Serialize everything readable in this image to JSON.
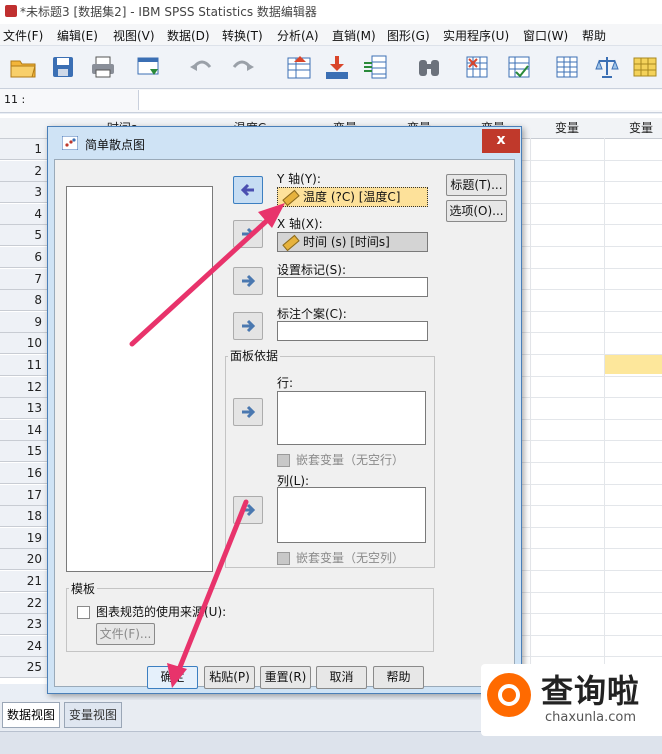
{
  "window": {
    "title": "*未标题3 [数据集2] - IBM SPSS Statistics 数据编辑器"
  },
  "menubar": {
    "items": [
      "文件(F)",
      "编辑(E)",
      "视图(V)",
      "数据(D)",
      "转换(T)",
      "分析(A)",
      "直销(M)",
      "图形(G)",
      "实用程序(U)",
      "窗口(W)",
      "帮助"
    ]
  },
  "toolbar": {
    "icons": [
      "open-folder-icon",
      "save-icon",
      "print-icon",
      "dialog-recall-icon",
      "undo-icon",
      "redo-icon",
      "goto-case-icon",
      "goto-variable-icon",
      "variables-icon",
      "find-icon",
      "insert-cases-icon",
      "split-file-icon",
      "weight-cases-icon",
      "select-cases-icon",
      "value-labels-icon",
      "use-sets-icon"
    ]
  },
  "cell_bar": {
    "ref": "11 :"
  },
  "grid": {
    "columns": [
      "时间s",
      "温度C",
      "变量",
      "变量",
      "变量",
      "变量",
      "变量"
    ],
    "rows": [
      "1",
      "2",
      "3",
      "4",
      "5",
      "6",
      "7",
      "8",
      "9",
      "10",
      "11",
      "12",
      "13",
      "14",
      "15",
      "16",
      "17",
      "18",
      "19",
      "20",
      "21",
      "22",
      "23",
      "24",
      "25"
    ]
  },
  "dialog": {
    "title": "简单散点图",
    "close": "x",
    "y_axis": {
      "label": "Y 轴(Y):",
      "value": "温度 (?C) [温度C]"
    },
    "x_axis": {
      "label": "X 轴(X):",
      "value": "时间 (s) [时间s]"
    },
    "set_markers": {
      "label": "设置标记(S):"
    },
    "label_cases": {
      "label": "标注个案(C):"
    },
    "panel_by": {
      "label": "面板依据",
      "rows_label": "行:",
      "rows_nest": "嵌套变量（无空行）",
      "cols_label": "列(L):",
      "cols_nest": "嵌套变量（无空列）"
    },
    "template": {
      "label": "模板",
      "use_chart_spec": "图表规范的使用来源(U):",
      "file_button": "文件(F)..."
    },
    "buttons": {
      "titles": "标题(T)...",
      "options": "选项(O)...",
      "ok": "确定",
      "paste": "粘贴(P)",
      "reset": "重置(R)",
      "cancel": "取消",
      "help": "帮助"
    }
  },
  "bottom_tabs": {
    "data_view": "数据视图",
    "variable_view": "变量视图"
  },
  "watermark": {
    "title": "查询啦",
    "url": "chaxunla.com"
  },
  "colors": {
    "selected_field": "#fde19a",
    "dialog_frame": "#cfe3f5",
    "annotation_arrow": "#e8336b",
    "watermark_logo": "#ff6a00"
  }
}
